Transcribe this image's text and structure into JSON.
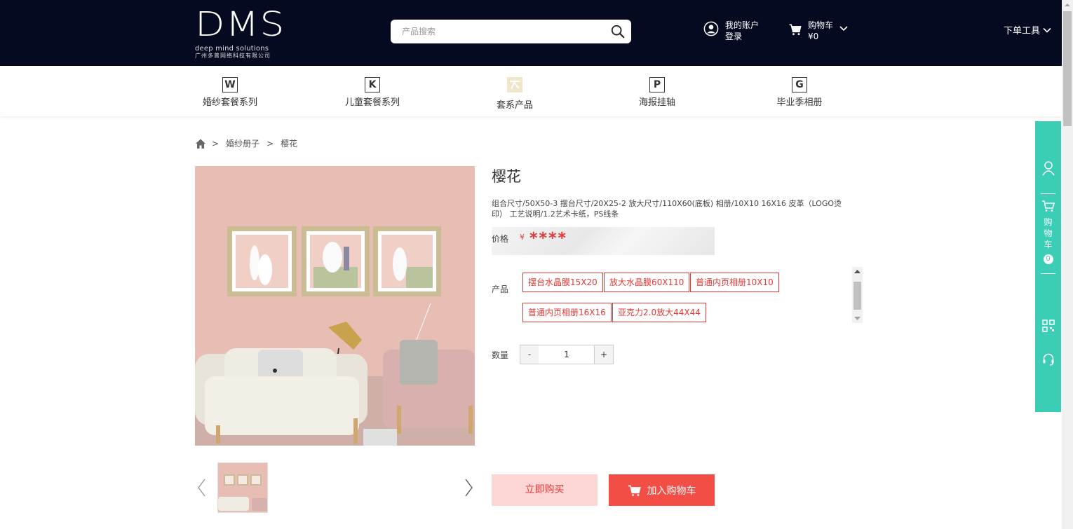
{
  "header": {
    "logo_mark": "DMS",
    "logo_sub": "deep mind solutions",
    "logo_cn": "广州多普网络科技有限公司",
    "search_placeholder": "产品搜索",
    "account_line1": "我的账户",
    "account_line2": "登录",
    "cart_line1": "购物车",
    "cart_line2": "¥0",
    "tools_label": "下单工具"
  },
  "nav": [
    {
      "icon": "W",
      "label": "婚纱套餐系列"
    },
    {
      "icon": "K",
      "label": "儿童套餐系列"
    },
    {
      "icon": "",
      "label": "套系产品"
    },
    {
      "icon": "P",
      "label": "海报挂轴"
    },
    {
      "icon": "G",
      "label": "毕业季相册"
    }
  ],
  "breadcrumb": {
    "sep": ">",
    "items": [
      "婚纱册子",
      "樱花"
    ]
  },
  "product": {
    "title": "樱花",
    "description": "组合尺寸/50X50-3 摆台尺寸/20X25-2 放大尺寸/110X60(底板) 相册/10X10 16X16 皮革（LOGO烫印） 工艺说明/1.2艺术卡纸，PS线条",
    "price_label": "价格",
    "currency": "¥",
    "price": "****",
    "options_label": "产品",
    "options": [
      "摆台水晶膜15X20",
      "放大水晶膜60X110",
      "普通内页相册10X10",
      "普通内页相册16X16",
      "亚克力2.0放大44X44"
    ],
    "qty_label": "数量",
    "qty_minus": "-",
    "qty_value": "1",
    "qty_plus": "+",
    "buy_now": "立即购买",
    "add_to_cart": "加入购物车"
  },
  "side_bar": {
    "cart_text": "购物车",
    "cart_count": "0"
  },
  "colors": {
    "header_bg": "#050a20",
    "accent": "#e53935",
    "side_bar": "#3ccdb7",
    "buy_now_bg": "#fcd5d5",
    "add_cart_bg": "#f24e46"
  }
}
